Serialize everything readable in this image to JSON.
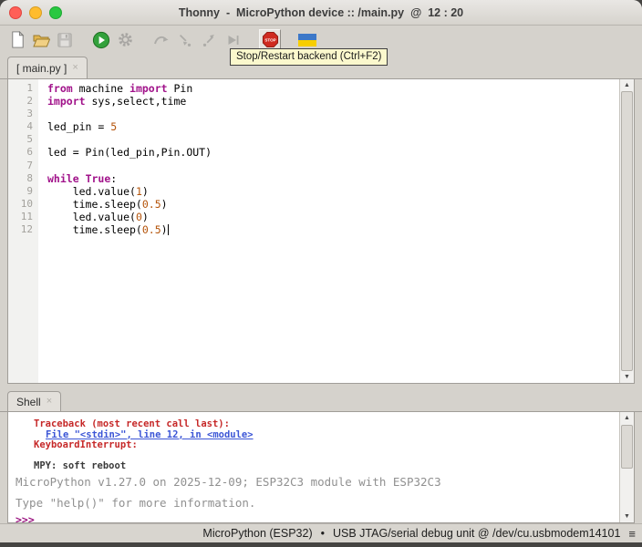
{
  "window": {
    "title": "Thonny  -  MicroPython device :: /main.py  @  12 : 20"
  },
  "toolbar": {
    "tooltip": "Stop/Restart backend (Ctrl+F2)",
    "stop_label": "STOP",
    "buttons": [
      {
        "id": "new-file",
        "enabled": true
      },
      {
        "id": "open-file",
        "enabled": true
      },
      {
        "id": "save",
        "enabled": false
      },
      {
        "id": "run",
        "enabled": true
      },
      {
        "id": "debug",
        "enabled": false
      },
      {
        "id": "step-over",
        "enabled": false
      },
      {
        "id": "step-into",
        "enabled": false
      },
      {
        "id": "step-out",
        "enabled": false
      },
      {
        "id": "resume",
        "enabled": false
      },
      {
        "id": "stop-restart",
        "enabled": true,
        "hovered": true
      },
      {
        "id": "support-ukraine",
        "enabled": true
      }
    ]
  },
  "editor": {
    "tab_label": "[ main.py ]",
    "close_glyph": "×",
    "lines": [
      {
        "n": 1,
        "tokens": [
          {
            "s": "from",
            "c": "kw"
          },
          {
            "s": " machine ",
            "c": "p"
          },
          {
            "s": "import",
            "c": "kw"
          },
          {
            "s": " Pin",
            "c": "p"
          }
        ]
      },
      {
        "n": 2,
        "tokens": [
          {
            "s": "import",
            "c": "kw"
          },
          {
            "s": " sys,select,time",
            "c": "p"
          }
        ]
      },
      {
        "n": 3,
        "tokens": []
      },
      {
        "n": 4,
        "tokens": [
          {
            "s": "led_pin = ",
            "c": "p"
          },
          {
            "s": "5",
            "c": "num"
          }
        ]
      },
      {
        "n": 5,
        "tokens": []
      },
      {
        "n": 6,
        "tokens": [
          {
            "s": "led = Pin(led_pin,Pin.OUT)",
            "c": "p"
          }
        ]
      },
      {
        "n": 7,
        "tokens": []
      },
      {
        "n": 8,
        "tokens": [
          {
            "s": "while",
            "c": "kw"
          },
          {
            "s": " ",
            "c": "p"
          },
          {
            "s": "True",
            "c": "kw"
          },
          {
            "s": ":",
            "c": "p"
          }
        ]
      },
      {
        "n": 9,
        "tokens": [
          {
            "s": "    led.value(",
            "c": "p"
          },
          {
            "s": "1",
            "c": "num"
          },
          {
            "s": ")",
            "c": "p"
          }
        ]
      },
      {
        "n": 10,
        "tokens": [
          {
            "s": "    time.sleep(",
            "c": "p"
          },
          {
            "s": "0.5",
            "c": "num"
          },
          {
            "s": ")",
            "c": "p"
          }
        ]
      },
      {
        "n": 11,
        "tokens": [
          {
            "s": "    led.value(",
            "c": "p"
          },
          {
            "s": "0",
            "c": "num"
          },
          {
            "s": ")",
            "c": "p"
          }
        ]
      },
      {
        "n": 12,
        "tokens": [
          {
            "s": "    time.sleep(",
            "c": "p"
          },
          {
            "s": "0.5",
            "c": "num"
          },
          {
            "s": ")",
            "c": "p"
          }
        ],
        "cursor": true
      }
    ]
  },
  "shell": {
    "tab_label": "Shell",
    "close_glyph": "×",
    "lines": [
      {
        "text": "Traceback (most recent call last):",
        "kind": "stderr",
        "indent": 1
      },
      {
        "text": "File \"<stdin>\", line 12, in <module>",
        "kind": "link",
        "indent": 2
      },
      {
        "text": "KeyboardInterrupt: ",
        "kind": "stderr",
        "indent": 1
      },
      {
        "text": "",
        "kind": "blank",
        "indent": 0
      },
      {
        "text": "MPY: soft reboot",
        "kind": "stdout",
        "indent": 1
      },
      {
        "text": "MicroPython v1.27.0 on 2025-12-09; ESP32C3 module with ESP32C3",
        "kind": "faded",
        "indent": 0
      },
      {
        "text": "Type \"help()\" for more information.",
        "kind": "faded",
        "indent": 0
      },
      {
        "text": ">>>",
        "kind": "prompt",
        "indent": 0
      }
    ]
  },
  "statusbar": {
    "backend": "MicroPython (ESP32)",
    "bullet": "•",
    "port": "USB JTAG/serial debug unit @ /dev/cu.usbmodem14101",
    "menu_glyph": "≡"
  },
  "colors": {
    "keyword": "#a1128a",
    "number": "#b45309",
    "shell_error": "#c62828",
    "shell_link": "#3b55d6",
    "shell_faded": "#909090",
    "prompt": "#970c7c",
    "run_green": "#33a13c",
    "stop_red": "#cf2b20",
    "flag_blue": "#3c78c8",
    "flag_yellow": "#f7ce00",
    "traffic_red": "#ff5f57",
    "traffic_yellow": "#febc2e",
    "traffic_green": "#28c840",
    "window_bg": "#d5d2cc",
    "tooltip_bg": "#fbf8cd"
  }
}
